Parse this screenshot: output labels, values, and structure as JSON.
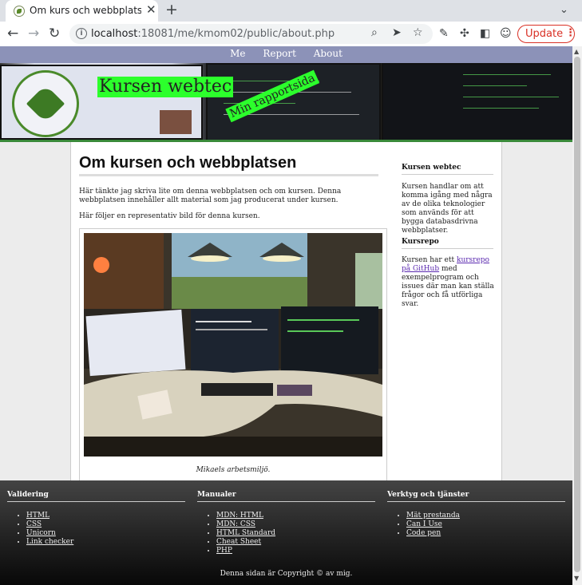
{
  "browser": {
    "tab_title": "Om kurs och webbplatsen",
    "url_host": "localhost",
    "url_rest": ":18081/me/kmom02/public/about.php",
    "update_label": "Update"
  },
  "nav": [
    "Me",
    "Report",
    "About"
  ],
  "header": {
    "site_title": "Kursen webtec",
    "slogan": "Min rapportsida",
    "logo_text": "BLEKINGE TEKNISKA HÖGSKOLA · BTH"
  },
  "article": {
    "title": "Om kursen och webbplatsen",
    "p1": "Här tänkte jag skriva lite om denna webbplatsen och om kursen. Denna webbplatsen innehåller allt material som jag producerat under kursen.",
    "p2": "Här följer en representativ bild för denna kursen.",
    "caption": "Mikaels arbetsmiljö."
  },
  "sidebar": {
    "h1": "Kursen webtec",
    "text1": "Kursen handlar om att komma igång med några av de olika teknologier som används för att bygga databasdrivna webbplatser.",
    "h2": "Kursrepo",
    "text2_before": "Kursen har ett ",
    "text2_link": "kursrepo på GitHub",
    "text2_after": " med exempelprogram och issues där man kan ställa frågor och få utförliga svar."
  },
  "footer": {
    "col1": {
      "title": "Validering",
      "links": [
        "HTML",
        "CSS",
        "Unicorn",
        "Link checker"
      ]
    },
    "col2": {
      "title": "Manualer",
      "links": [
        "MDN: HTML",
        "MDN: CSS",
        "HTML Standard",
        "Cheat Sheet",
        "PHP"
      ]
    },
    "col3": {
      "title": "Verktyg och tjänster",
      "links": [
        "Mät prestanda",
        "Can I Use",
        "Code pen"
      ]
    },
    "copyright": "Denna sidan är Copyright © av mig."
  }
}
